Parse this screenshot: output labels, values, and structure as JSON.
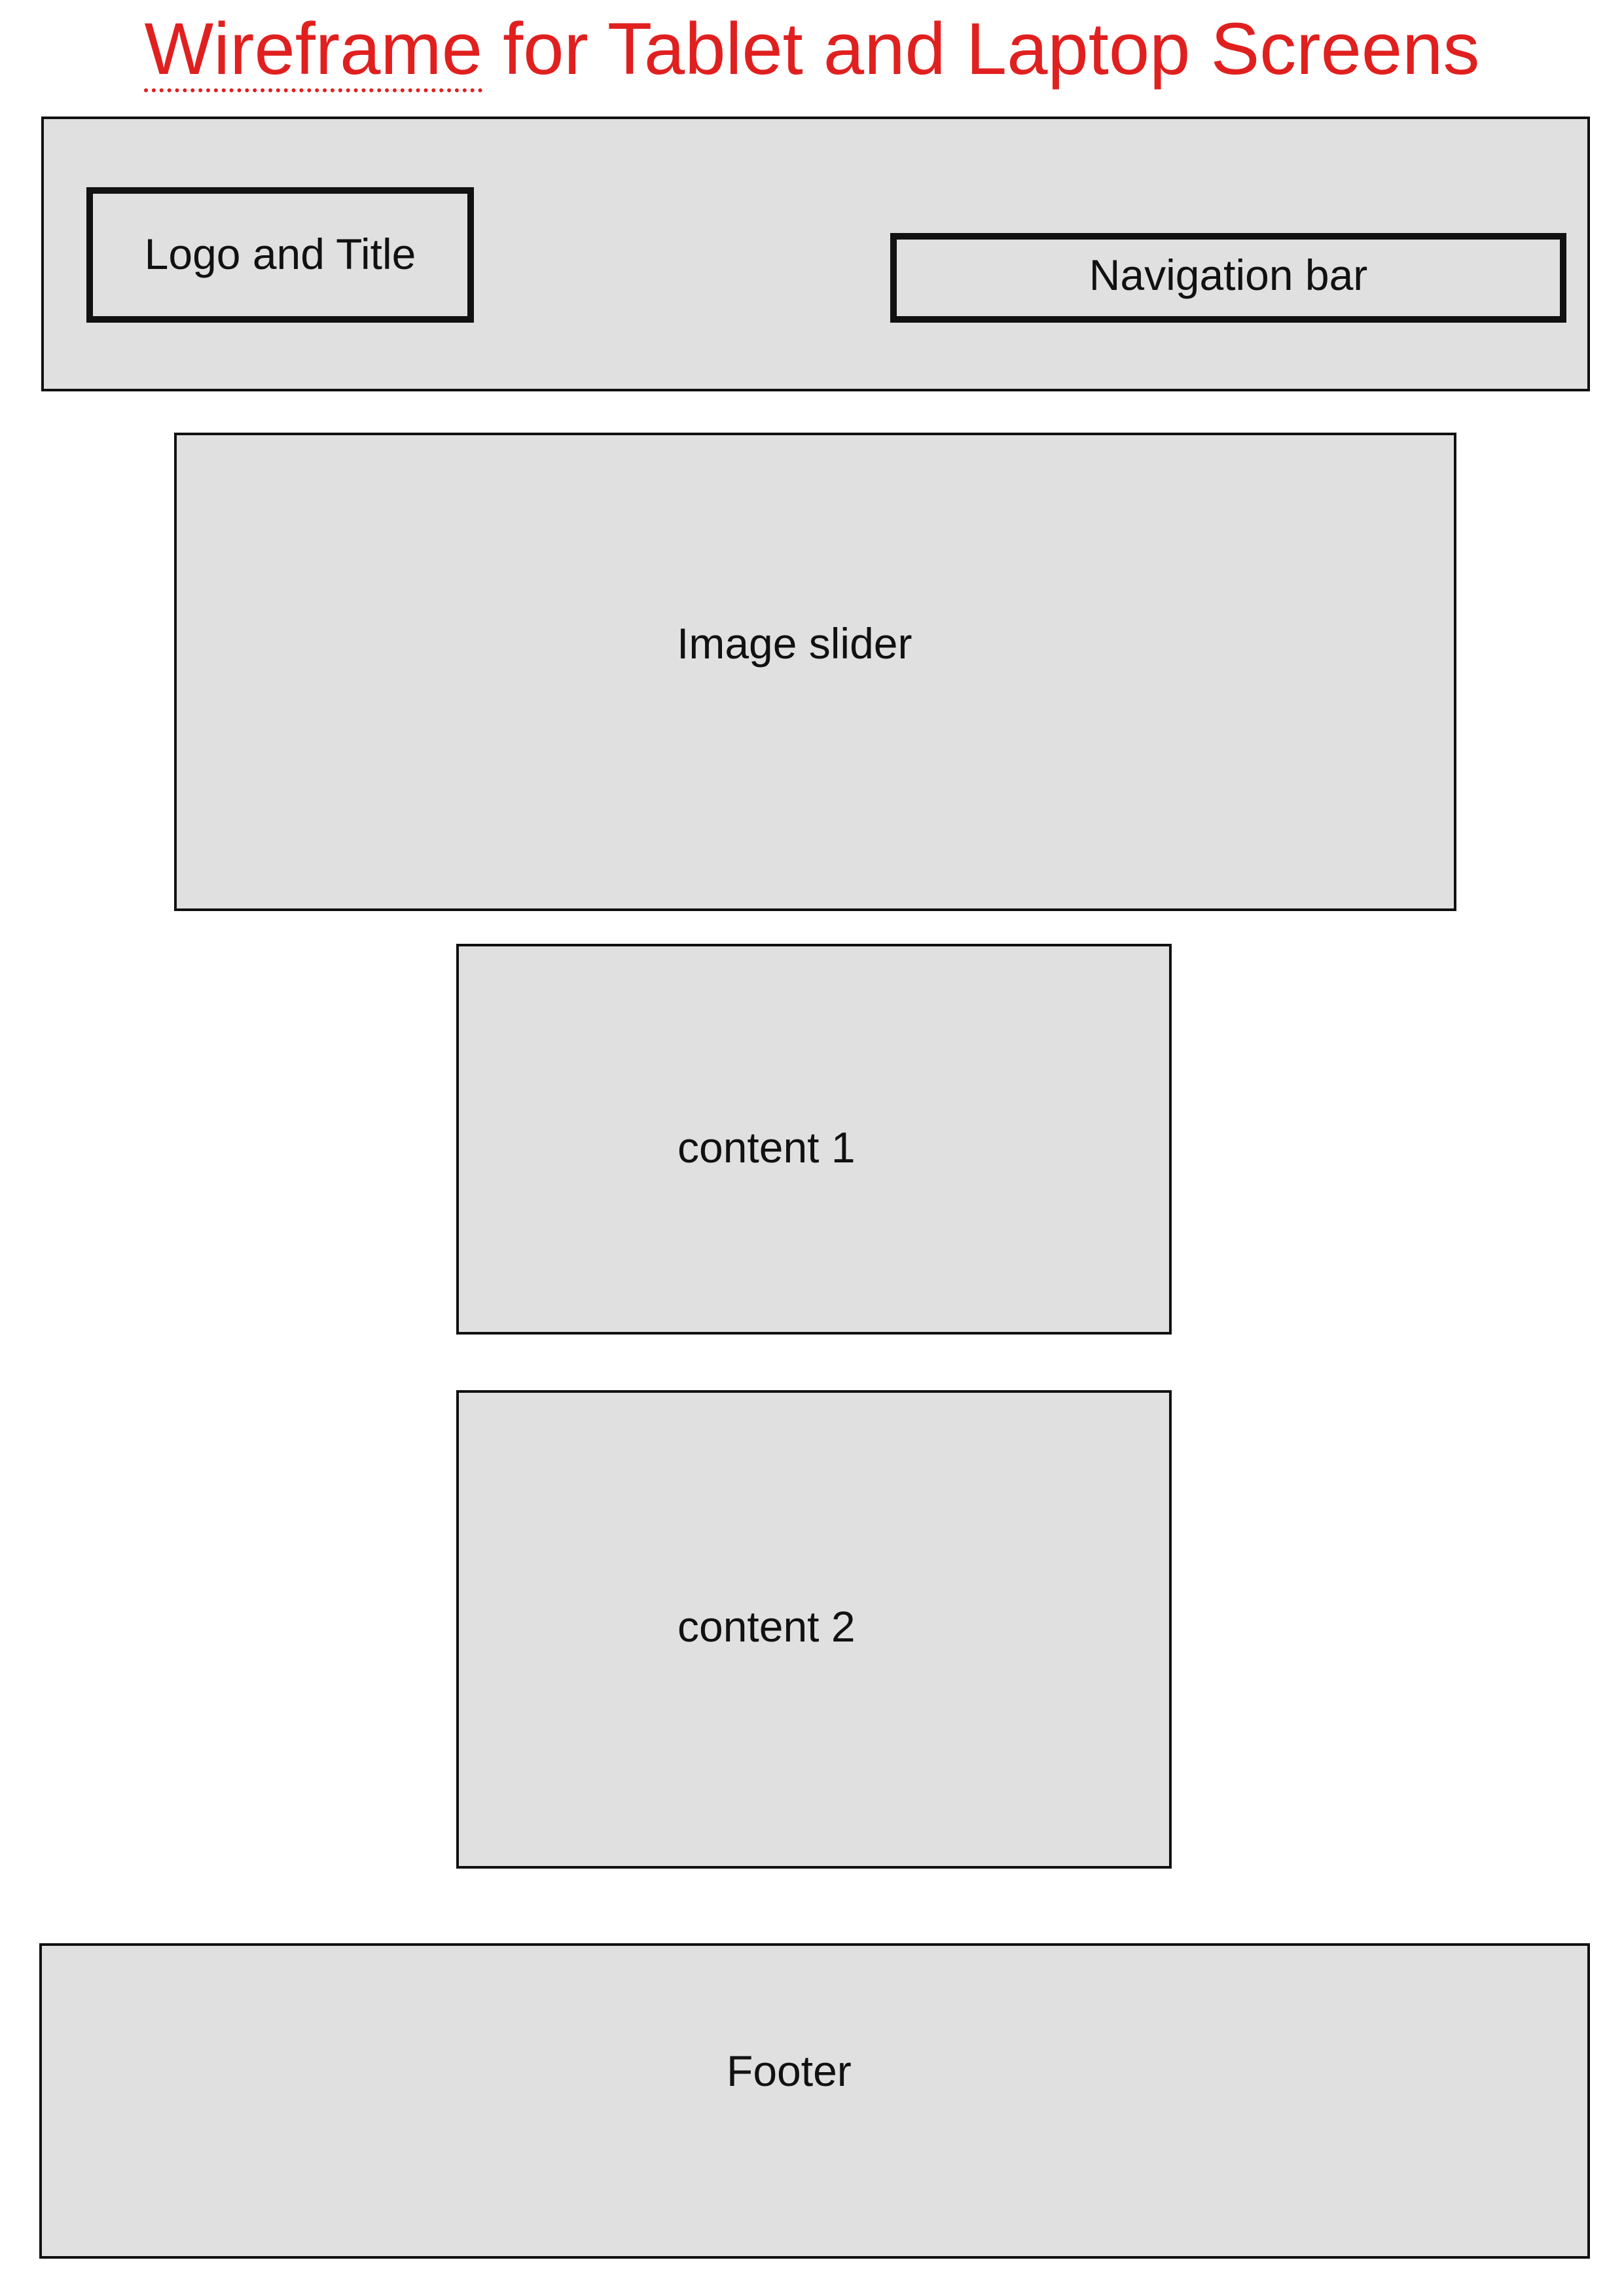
{
  "title": {
    "first_word": "Wireframe",
    "rest": " for Tablet and Laptop Screens"
  },
  "header": {
    "logo_label": "Logo and Title",
    "nav_label": "Navigation bar"
  },
  "slider": {
    "label": "Image slider"
  },
  "contents": [
    {
      "label": "content 1"
    },
    {
      "label": "content 2"
    }
  ],
  "footer": {
    "label": "Footer"
  },
  "colors": {
    "title": "#e0201f",
    "box_fill": "#e0e0e0",
    "border": "#111111",
    "background": "#ffffff"
  }
}
